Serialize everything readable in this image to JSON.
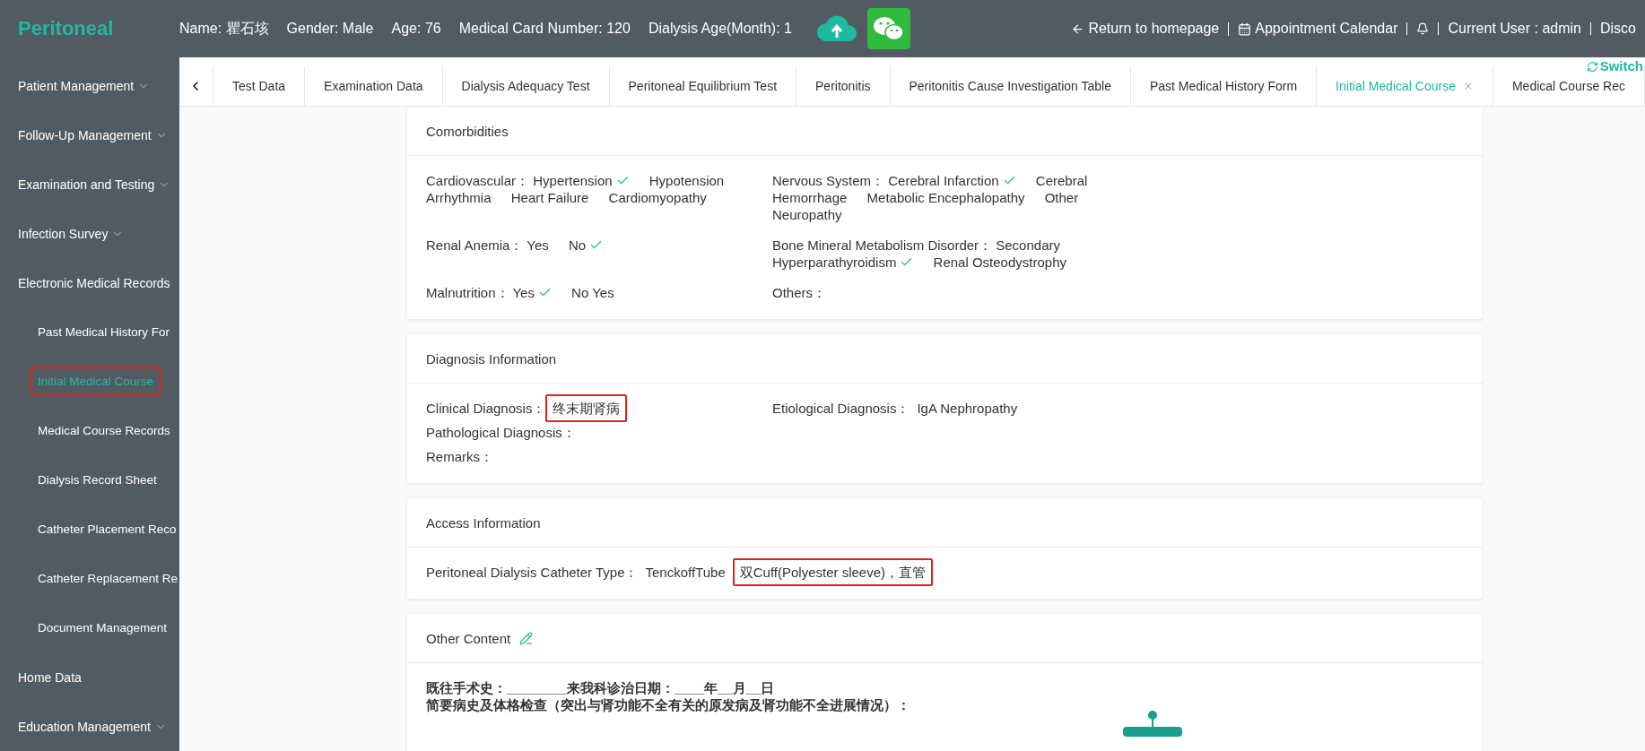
{
  "header": {
    "logo": "Peritoneal",
    "patient_fields": [
      "Name: 瞿石垓",
      "Gender: Male",
      "Age: 76",
      "Medical Card Number: 120",
      "Dialysis Age(Month): 1"
    ],
    "nav": [
      {
        "kind": "back",
        "label": "Return to homepage"
      },
      {
        "kind": "calendar",
        "label": "Appointment Calendar"
      },
      {
        "kind": "bell"
      },
      {
        "kind": "text",
        "label": "Current User : admin"
      },
      {
        "kind": "text",
        "label": "Disco"
      }
    ],
    "switch_label": "Switch"
  },
  "sidebar": {
    "items": [
      {
        "label": "Patient Management",
        "kind": "group",
        "expanded": false
      },
      {
        "label": "Follow-Up Management",
        "kind": "group",
        "expanded": false
      },
      {
        "label": "Examination and Testing",
        "kind": "group",
        "expanded": false
      },
      {
        "label": "Infection Survey",
        "kind": "group",
        "expanded": false
      },
      {
        "label": "Electronic Medical Records",
        "kind": "group",
        "expanded": true,
        "children": [
          {
            "label": "Past Medical History For",
            "selected": false,
            "annotated": false
          },
          {
            "label": "Initial Medical Course",
            "selected": true,
            "annotated": true
          },
          {
            "label": "Medical Course Records",
            "selected": false,
            "annotated": false
          },
          {
            "label": "Dialysis Record Sheet",
            "selected": false,
            "annotated": false
          },
          {
            "label": "Catheter Placement Reco",
            "selected": false,
            "annotated": false
          },
          {
            "label": "Catheter Replacement Re",
            "selected": false,
            "annotated": false
          },
          {
            "label": "Document Management",
            "selected": false,
            "annotated": false
          }
        ]
      },
      {
        "label": "Home Data",
        "kind": "link"
      },
      {
        "label": "Education Management",
        "kind": "group",
        "expanded": false
      }
    ]
  },
  "tabs": [
    {
      "label": "Test Data",
      "selected": false
    },
    {
      "label": "Examination Data",
      "selected": false
    },
    {
      "label": "Dialysis Adequacy Test",
      "selected": false
    },
    {
      "label": "Peritoneal Equilibrium Test",
      "selected": false
    },
    {
      "label": "Peritonitis",
      "selected": false
    },
    {
      "label": "Peritonitis Cause Investigation Table",
      "selected": false
    },
    {
      "label": "Past Medical History Form",
      "selected": false
    },
    {
      "label": "Initial Medical Course",
      "selected": true
    },
    {
      "label": "Medical Course Rec",
      "selected": false
    }
  ],
  "sections": [
    {
      "title": "Comorbidities",
      "kind": "options",
      "fields": [
        {
          "label": "Cardiovascular：",
          "options": [
            {
              "label": "Hypertension",
              "checked": true
            },
            {
              "label": "Hypotension",
              "checked": false
            },
            {
              "label": "Arrhythmia",
              "checked": false
            },
            {
              "label": "Heart Failure",
              "checked": false
            },
            {
              "label": "Cardiomyopathy",
              "checked": false
            }
          ]
        },
        {
          "label": "Nervous System：",
          "options": [
            {
              "label": "Cerebral Infarction",
              "checked": true
            },
            {
              "label": "Cerebral Hemorrhage",
              "checked": false
            },
            {
              "label": "Metabolic Encephalopathy",
              "checked": false
            },
            {
              "label": "Other Neuropathy",
              "checked": false
            }
          ]
        },
        {
          "label": "Renal Anemia：",
          "options": [
            {
              "label": "Yes",
              "checked": false
            },
            {
              "label": "No",
              "checked": true
            }
          ]
        },
        {
          "label": "Bone Mineral Metabolism Disorder：",
          "options": [
            {
              "label": "Secondary Hyperparathyroidism",
              "checked": true
            },
            {
              "label": "Renal Osteodystrophy",
              "checked": false
            }
          ]
        },
        {
          "label": "Malnutrition：",
          "options": [
            {
              "label": "Yes",
              "checked": true
            },
            {
              "label": "No Yes",
              "checked": false
            }
          ]
        },
        {
          "label": "Others："
        }
      ]
    },
    {
      "title": "Diagnosis Information",
      "kind": "values",
      "rows": [
        [
          {
            "label": "Clinical Diagnosis：",
            "values": [
              {
                "text": "终末期肾病",
                "annotated": true
              }
            ]
          },
          {
            "label": "Etiological Diagnosis：",
            "values": [
              {
                "text": "IgA Nephropathy",
                "annotated": false
              }
            ]
          }
        ],
        [
          {
            "label": "Pathological Diagnosis："
          }
        ],
        [
          {
            "label": "Remarks："
          }
        ]
      ]
    },
    {
      "title": "Access Information",
      "kind": "values",
      "rows": [
        [
          {
            "label": "Peritoneal Dialysis Catheter Type：",
            "values": [
              {
                "text": "TenckoffTube",
                "annotated": false
              },
              {
                "text": "双Cuff(Polyester sleeve)，直管",
                "annotated": true
              }
            ]
          }
        ]
      ]
    },
    {
      "title": "Other Content",
      "kind": "text",
      "editable": true,
      "lines": [
        "既往手术史：________来我科诊治日期：____年__月__日",
        "简要病史及体格检查（突出与肾功能不全有关的原发病及肾功能不全进展情况）："
      ]
    }
  ]
}
